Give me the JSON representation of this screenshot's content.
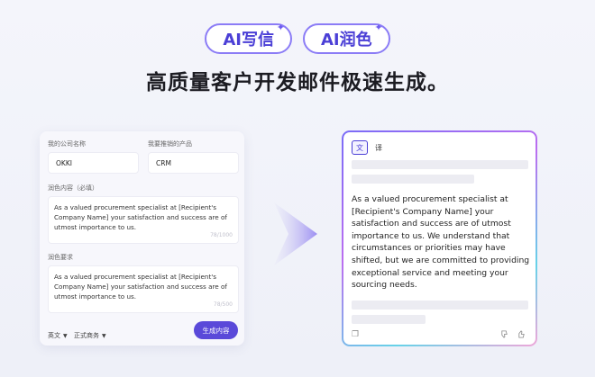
{
  "header": {
    "pill_1": "AI写信",
    "pill_2": "AI润色",
    "headline": "高质量客户开发邮件极速生成。"
  },
  "form": {
    "company_label": "我的公司名称",
    "company_value": "OKKI",
    "product_label": "我要推销的产品",
    "product_value": "CRM",
    "polish_label": "润色内容（必填）",
    "polish_value": "As a valued procurement specialist at [Recipient's Company Name] your satisfaction and success are of utmost importance to us.",
    "polish_count": "78/1000",
    "requirement_label": "润色要求",
    "requirement_value": "As a valued procurement specialist at [Recipient's Company Name] your satisfaction and success are of utmost importance to us.",
    "requirement_count": "78/500",
    "language_select": "英文",
    "tone_select": "正式商务",
    "generate_button": "生成内容"
  },
  "result": {
    "tab_original": "文",
    "tab_translate": "译",
    "text": "As a valued procurement specialist at [Recipient's Company Name] your satisfaction and success are of utmost importance to us. We understand that circumstances or priorities may have shifted, but we are committed to providing exceptional service and meeting your sourcing needs."
  },
  "icons": {
    "pill_spark": "sparkle-icon",
    "select_chevron": "chevron-down-icon",
    "arrow": "arrow-right-icon",
    "copy": "copy-icon",
    "dislike": "thumbs-down-icon",
    "like": "thumbs-up-icon"
  },
  "colors": {
    "accent": "#5a49d9",
    "pill_border": "#8b7cf6"
  }
}
